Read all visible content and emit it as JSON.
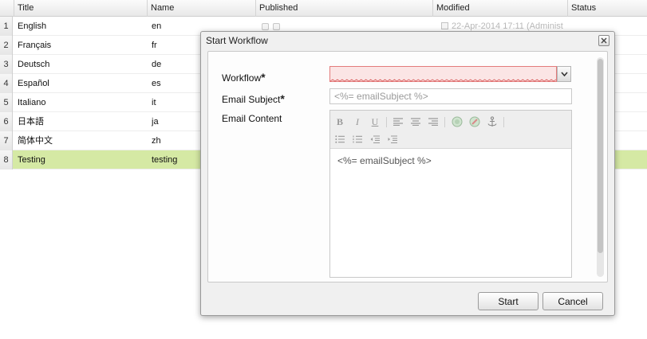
{
  "grid": {
    "columns": [
      "Title",
      "Name",
      "Published",
      "Modified",
      "Status"
    ],
    "rows": [
      {
        "num": "1",
        "title": "English",
        "name": "en",
        "modified": "22-Apr-2014 17:11 (Administ"
      },
      {
        "num": "2",
        "title": "Français",
        "name": "fr"
      },
      {
        "num": "3",
        "title": "Deutsch",
        "name": "de"
      },
      {
        "num": "4",
        "title": "Español",
        "name": "es"
      },
      {
        "num": "5",
        "title": "Italiano",
        "name": "it"
      },
      {
        "num": "6",
        "title": "日本語",
        "name": "ja"
      },
      {
        "num": "7",
        "title": "简体中文",
        "name": "zh"
      },
      {
        "num": "8",
        "title": "Testing",
        "name": "testing"
      }
    ],
    "selected_row": 8,
    "selected_color": "#d5e9a4"
  },
  "dialog": {
    "title": "Start Workflow",
    "fields": {
      "workflow_label": "Workflow",
      "subject_label": "Email Subject",
      "content_label": "Email Content",
      "required_marker": "*",
      "workflow_value": "",
      "subject_placeholder": "<%= emailSubject %>",
      "content_value": "<%= emailSubject %>"
    },
    "toolbar_icons": [
      "bold-icon",
      "italic-icon",
      "underline-icon",
      "align-left-icon",
      "align-center-icon",
      "align-right-icon",
      "insert-link-icon",
      "remove-link-icon",
      "anchor-icon",
      "bullet-list-icon",
      "numbered-list-icon",
      "outdent-icon",
      "indent-icon"
    ],
    "buttons": {
      "start": "Start",
      "cancel": "Cancel"
    },
    "error_color": "#e37b7b"
  }
}
